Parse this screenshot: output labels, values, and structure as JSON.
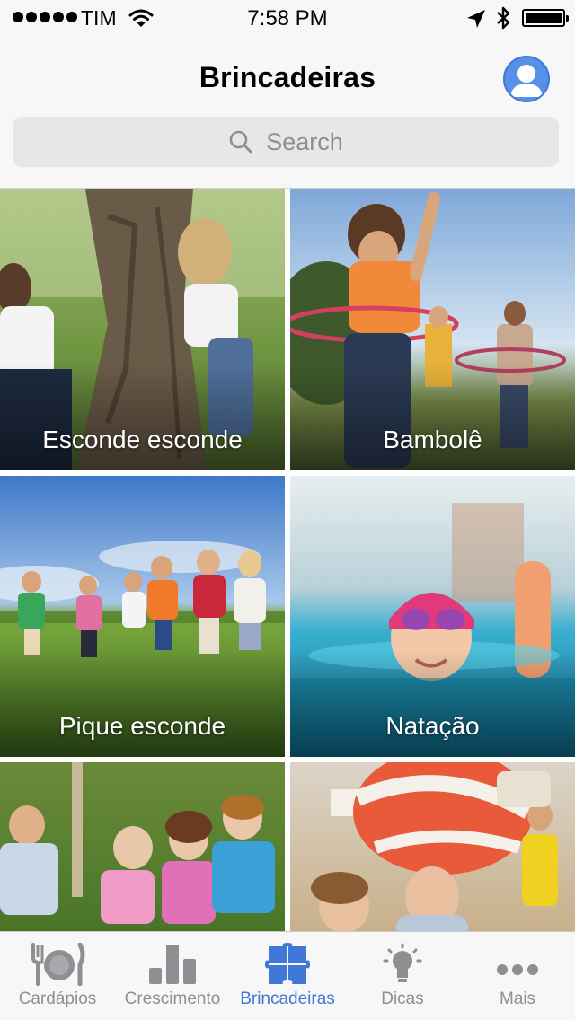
{
  "status_bar": {
    "carrier": "TIM",
    "time": "7:58 PM",
    "icons": [
      "signal-dots",
      "wifi-icon",
      "location-arrow-icon",
      "bluetooth-icon",
      "battery-icon"
    ]
  },
  "nav": {
    "title": "Brincadeiras",
    "profile_icon": "user-profile-icon",
    "accent_color": "#3f78d6"
  },
  "search": {
    "placeholder": "Search",
    "icon": "search-icon"
  },
  "tiles": [
    {
      "label": "Esconde esconde"
    },
    {
      "label": "Bambolê"
    },
    {
      "label": "Pique esconde"
    },
    {
      "label": "Natação"
    },
    {
      "label": ""
    },
    {
      "label": ""
    }
  ],
  "tab_bar": {
    "active_color": "#3f78d6",
    "inactive_color": "#8e8e93",
    "tabs": [
      {
        "label": "Cardápios",
        "icon": "plate-utensils-icon",
        "active": false
      },
      {
        "label": "Crescimento",
        "icon": "bar-chart-icon",
        "active": false
      },
      {
        "label": "Brincadeiras",
        "icon": "puzzle-icon",
        "active": true
      },
      {
        "label": "Dicas",
        "icon": "lightbulb-icon",
        "active": false
      },
      {
        "label": "Mais",
        "icon": "more-dots-icon",
        "active": false
      }
    ]
  }
}
